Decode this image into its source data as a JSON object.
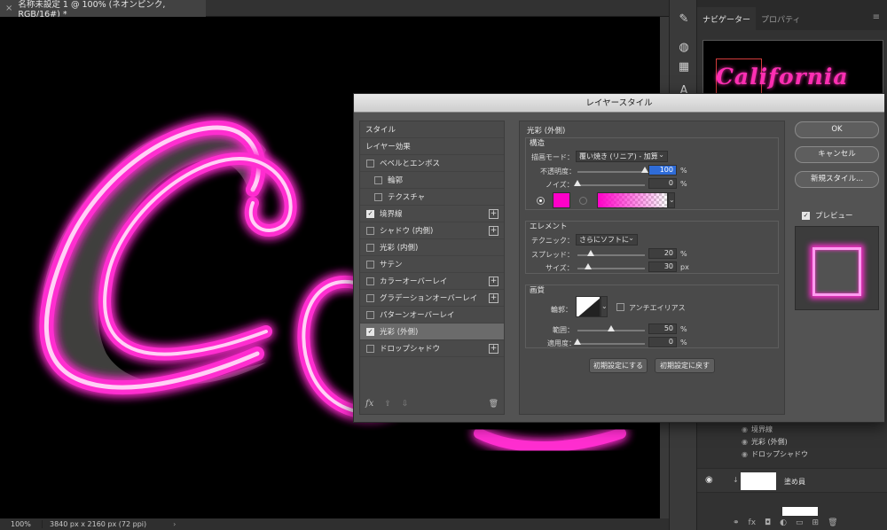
{
  "document": {
    "tab_title": "名称未設定 1 @ 100% (ネオンピンク, RGB/16#) *",
    "zoom": "100%",
    "info": "3840 px x 2160 px (72 ppi)"
  },
  "right_panel": {
    "tabs": [
      "ナビゲーター",
      "プロパティ"
    ],
    "navigator_text": "California"
  },
  "layers": {
    "effects": [
      "境界線",
      "光彩 (外側)",
      "ドロップシャドウ"
    ],
    "layer_name": "塗め員"
  },
  "dialog": {
    "title": "レイヤースタイル",
    "style_list": {
      "header_style": "スタイル",
      "header_effects": "レイヤー効果",
      "items": [
        {
          "label": "ベベルとエンボス",
          "checked": false,
          "sub": false,
          "plus": false
        },
        {
          "label": "輪郭",
          "checked": false,
          "sub": true,
          "plus": false
        },
        {
          "label": "テクスチャ",
          "checked": false,
          "sub": true,
          "plus": false
        },
        {
          "label": "境界線",
          "checked": true,
          "sub": false,
          "plus": true
        },
        {
          "label": "シャドウ (内側)",
          "checked": false,
          "sub": false,
          "plus": true
        },
        {
          "label": "光彩 (内側)",
          "checked": false,
          "sub": false,
          "plus": false
        },
        {
          "label": "サテン",
          "checked": false,
          "sub": false,
          "plus": false
        },
        {
          "label": "カラーオーバーレイ",
          "checked": false,
          "sub": false,
          "plus": true
        },
        {
          "label": "グラデーションオーバーレイ",
          "checked": false,
          "sub": false,
          "plus": true
        },
        {
          "label": "パターンオーバーレイ",
          "checked": false,
          "sub": false,
          "plus": false
        },
        {
          "label": "光彩 (外側)",
          "checked": true,
          "sub": false,
          "plus": false,
          "selected": true
        },
        {
          "label": "ドロップシャドウ",
          "checked": false,
          "sub": false,
          "plus": true
        }
      ],
      "footer_fx": "fx"
    },
    "outer_glow": {
      "title": "光彩 (外側)",
      "structure": {
        "title": "構造",
        "blend_mode_label": "描画モード：",
        "blend_mode_value": "覆い焼き (リニア) - 加算",
        "opacity_label": "不透明度：",
        "opacity_value": "100",
        "opacity_unit": "%",
        "opacity_level": 1.0,
        "noise_label": "ノイズ：",
        "noise_value": "0",
        "noise_unit": "%",
        "noise_level": 0.0,
        "glow_color": "#ff00c8"
      },
      "elements": {
        "title": "エレメント",
        "technique_label": "テクニック：",
        "technique_value": "さらにソフトに",
        "spread_label": "スプレッド：",
        "spread_value": "20",
        "spread_unit": "%",
        "spread_level": 0.2,
        "size_label": "サイズ：",
        "size_value": "30",
        "size_unit": "px"
      },
      "quality": {
        "title": "画質",
        "contour_label": "輪郭：",
        "antialias_label": "アンチエイリアス",
        "range_label": "範囲：",
        "range_value": "50",
        "range_unit": "%",
        "range_level": 0.5,
        "jitter_label": "適用度：",
        "jitter_value": "0",
        "jitter_unit": "%",
        "jitter_level": 0.0
      },
      "make_default": "初期設定にする",
      "reset_default": "初期設定に戻す"
    },
    "ok": "OK",
    "cancel": "キャンセル",
    "new_style": "新規スタイル...",
    "preview": "プレビュー"
  }
}
